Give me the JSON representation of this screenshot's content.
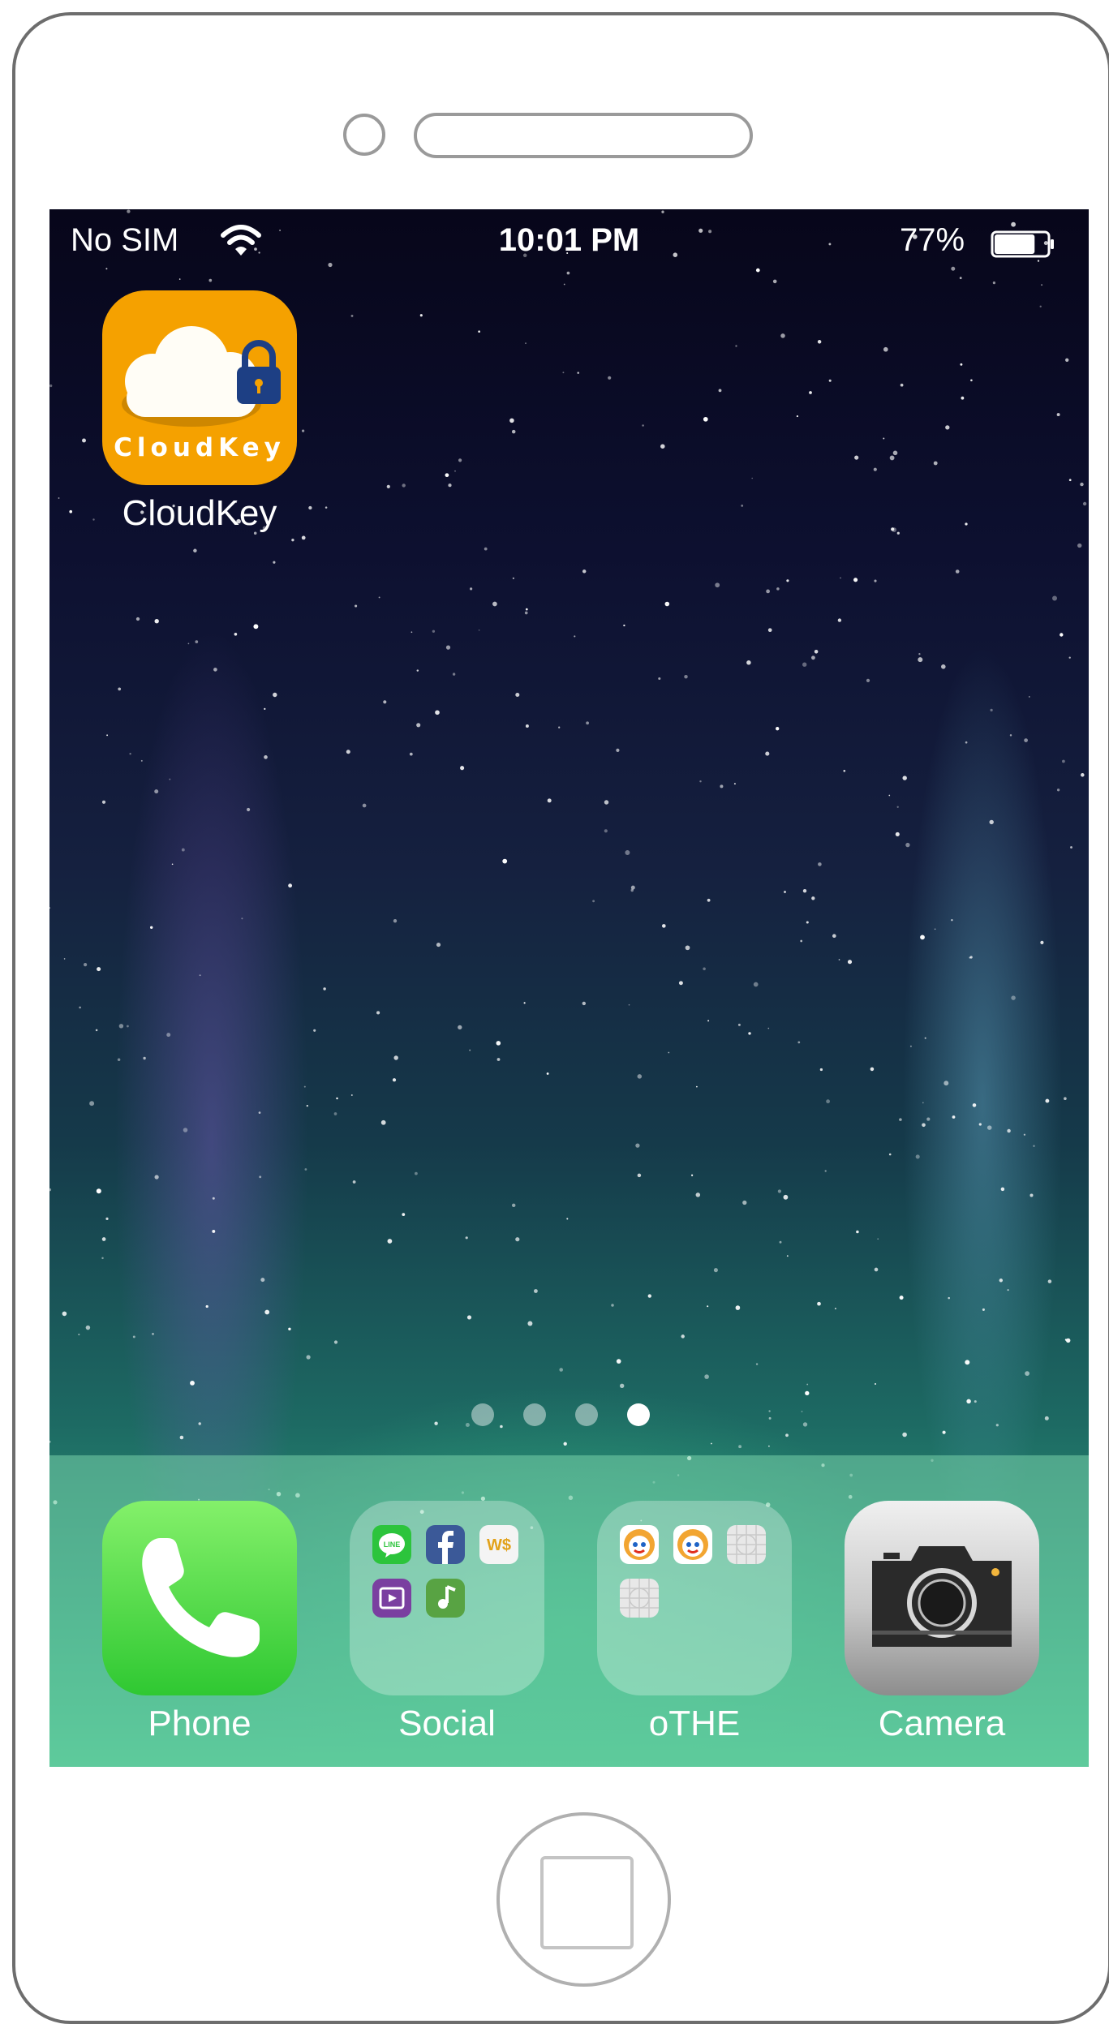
{
  "status_bar": {
    "carrier": "No SIM",
    "time": "10:01 PM",
    "battery_percent": "77%",
    "battery_level": 0.77,
    "wifi_icon": "wifi-icon",
    "battery_icon": "battery-icon"
  },
  "home_screen": {
    "apps": [
      {
        "label": "CloudKey",
        "icon_text": "CloudKey",
        "icon": "cloud-lock-icon"
      }
    ]
  },
  "page_indicator": {
    "total": 4,
    "current": 4
  },
  "dock": {
    "apps": [
      {
        "label": "Phone",
        "icon": "phone-handset-icon"
      },
      {
        "label": "Social",
        "icon": "folder-icon",
        "folder_apps": [
          "line-icon",
          "facebook-icon",
          "wallet-icon",
          "video-icon",
          "music-icon"
        ]
      },
      {
        "label": "oTHE",
        "icon": "folder-icon",
        "folder_apps": [
          "face-app-icon",
          "face-app-icon",
          "grid-app-icon",
          "grid-app-icon"
        ]
      },
      {
        "label": "Camera",
        "icon": "camera-icon"
      }
    ]
  },
  "colors": {
    "cloudkey_orange": "#f5a100",
    "phone_green": "#3ad13b"
  }
}
